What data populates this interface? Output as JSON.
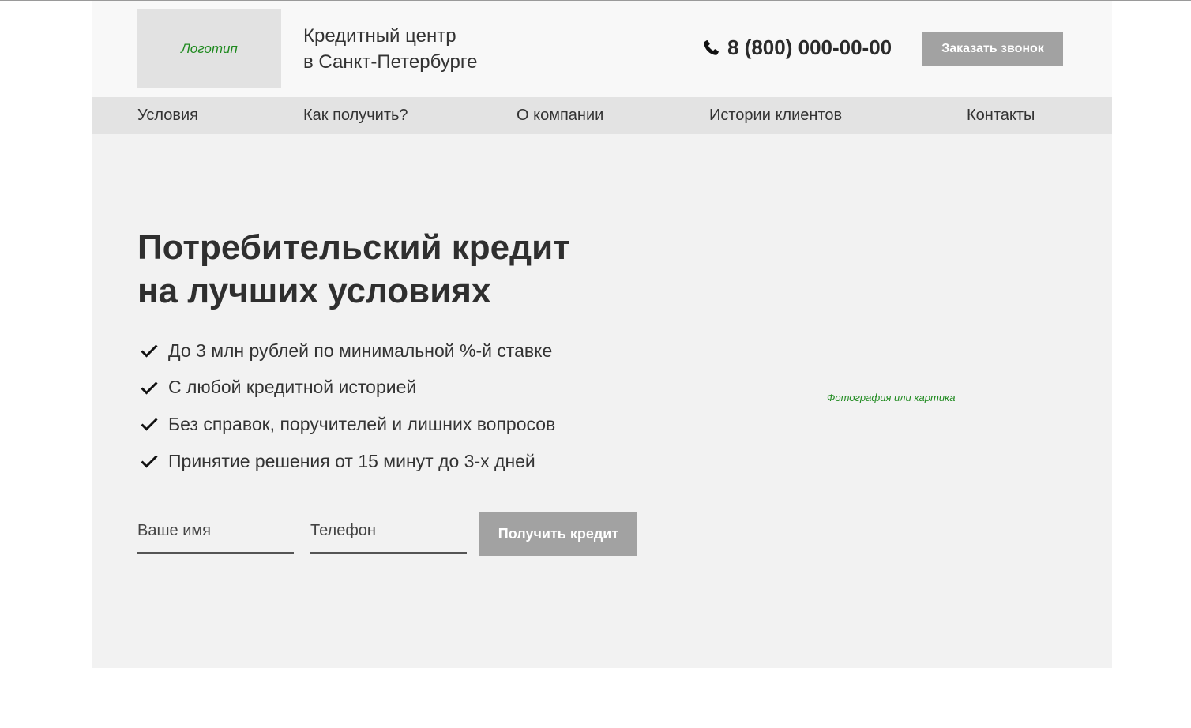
{
  "header": {
    "logo_text": "Логотип",
    "company_line1": "Кредитный центр",
    "company_line2": "в Санкт-Петербурге",
    "phone_icon": "phone-icon",
    "phone": "8 (800) 000-00-00",
    "callback_button": "Заказать звонок"
  },
  "nav": {
    "items": [
      {
        "label": "Условия"
      },
      {
        "label": "Как получить?"
      },
      {
        "label": "О компании"
      },
      {
        "label": "Истории клиентов"
      },
      {
        "label": "Контакты"
      }
    ]
  },
  "hero": {
    "title_line1": "Потребительский кредит",
    "title_line2": "на лучших условиях",
    "check_icon": "check-icon",
    "features": [
      "До 3 млн рублей по минимальной %-й ставке",
      "С любой кредитной историей",
      "Без справок, поручителей и лишних вопросов",
      "Принятие решения от 15 минут до 3-х дней"
    ],
    "form": {
      "name_placeholder": "Ваше имя",
      "phone_placeholder": "Телефон",
      "submit_label": "Получить кредит"
    },
    "photo_placeholder": "Фотография или картика"
  },
  "colors": {
    "page_bg": "#ffffff",
    "site_bg": "#f2f2f2",
    "header_bg": "#f8f8f8",
    "nav_bg": "#e3e3e3",
    "logo_bg": "#e2e2e2",
    "button_bg": "#a2a2a2",
    "placeholder_text": "#1f8a1f"
  }
}
